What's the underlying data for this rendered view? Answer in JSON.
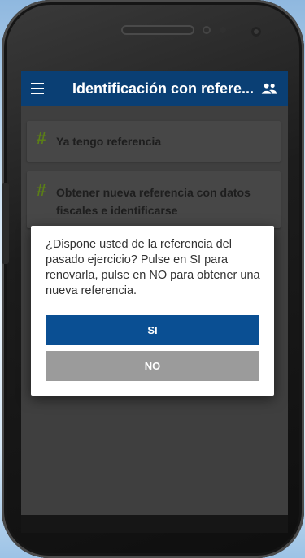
{
  "appbar": {
    "title": "Identificación con refere..."
  },
  "options": [
    {
      "marker": "#",
      "label": "Ya tengo referencia"
    },
    {
      "marker": "#",
      "label": "Obtener nueva referencia con datos fiscales e identificarse"
    }
  ],
  "dialog": {
    "message": "¿Dispone usted de la referencia del pasado ejercicio? Pulse en SI para renovarla, pulse en NO para obtener una nueva referencia.",
    "yes_label": "SI",
    "no_label": "NO"
  },
  "colors": {
    "appbar": "#0a3f74",
    "accent_hash": "#5b7f16",
    "yes_button": "#0a4f93",
    "no_button": "#9b9b9b"
  },
  "icons": [
    "menu-icon",
    "people-icon"
  ]
}
